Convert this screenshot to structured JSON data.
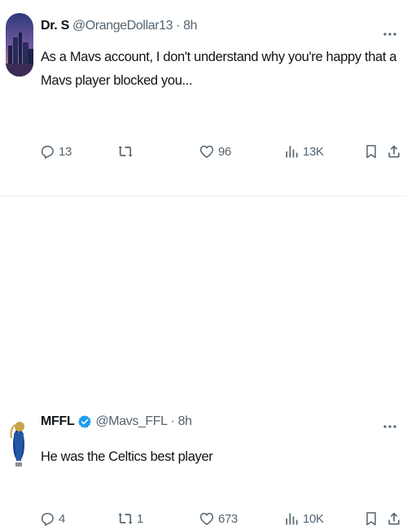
{
  "tweets": [
    {
      "author": {
        "name": "Dr. S",
        "handle": "@OrangeDollar13",
        "verified": false
      },
      "separator": "·",
      "time": "8h",
      "text": "As a Mavs account, I don't understand why you're happy that a Mavs player blocked you...",
      "stats": {
        "replies": "13",
        "retweets": "",
        "likes": "96",
        "views": "13K"
      }
    },
    {
      "author": {
        "name": "MFFL",
        "handle": "@Mavs_FFL",
        "verified": true
      },
      "separator": "·",
      "time": "8h",
      "text": "He was the Celtics best player",
      "stats": {
        "replies": "4",
        "retweets": "1",
        "likes": "673",
        "views": "10K"
      }
    }
  ],
  "icons": {
    "more": "more-dots-icon",
    "reply": "reply-bubble-icon",
    "retweet": "retweet-arrows-icon",
    "like": "heart-icon",
    "views": "analytics-bars-icon",
    "bookmark": "bookmark-icon",
    "share": "share-upload-icon",
    "verified": "verified-badge-icon"
  },
  "colors": {
    "text": "#0f1419",
    "muted": "#536471",
    "verified": "#1d9bf0",
    "divider": "#e8ecef"
  }
}
